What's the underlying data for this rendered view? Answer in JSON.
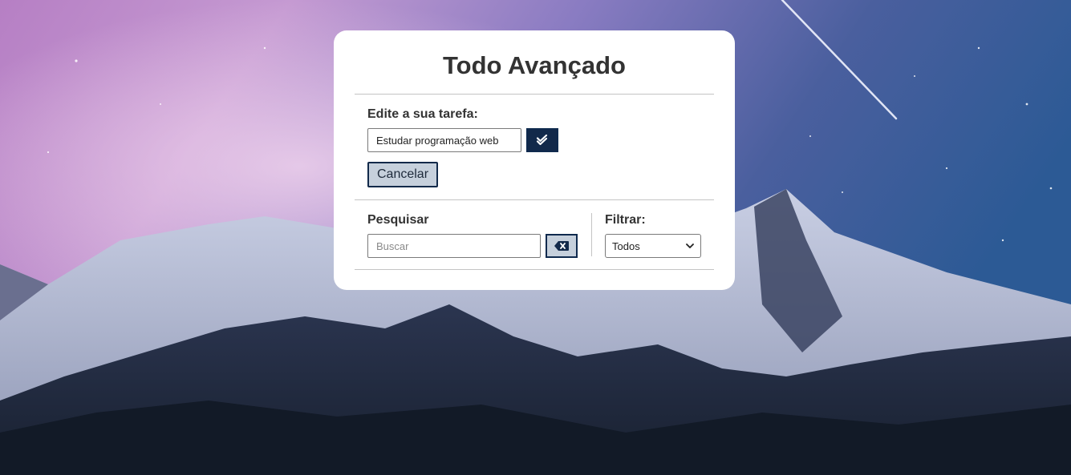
{
  "app": {
    "title": "Todo Avançado"
  },
  "edit": {
    "label": "Edite a sua tarefa:",
    "value": "Estudar programação web",
    "confirm_icon": "double-check-icon",
    "cancel_label": "Cancelar"
  },
  "search": {
    "label": "Pesquisar",
    "placeholder": "Buscar",
    "clear_icon": "backspace-icon"
  },
  "filter": {
    "label": "Filtrar:",
    "selected": "Todos"
  },
  "colors": {
    "accent_dark": "#12294a",
    "button_light": "#c6d0dc",
    "card_bg": "#ffffff",
    "text": "#333333"
  }
}
